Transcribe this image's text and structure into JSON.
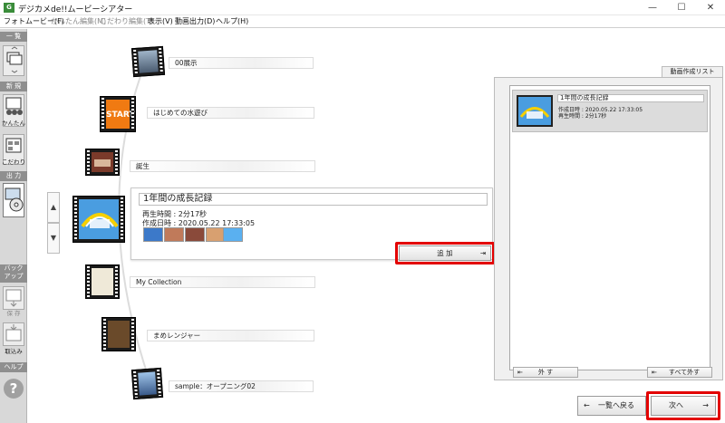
{
  "window": {
    "title": "デジカメde!!ムービーシアター",
    "app_icon": "G",
    "minimize": "—",
    "maximize": "☐",
    "close": "✕"
  },
  "menu": [
    {
      "label": "フォトムービー(F)",
      "enabled": true
    },
    {
      "label": "かんたん編集(M)",
      "enabled": false
    },
    {
      "label": "こだわり編集(T)",
      "enabled": false
    },
    {
      "label": "表示(V)",
      "enabled": true
    },
    {
      "label": "動画出力(D)",
      "enabled": true
    },
    {
      "label": "ヘルプ(H)",
      "enabled": true
    }
  ],
  "sidebar": {
    "list_header": "一 覧",
    "new_header": "新 規",
    "easy_label": "かんたん",
    "custom_label": "こだわり",
    "output_header": "出 力",
    "backup_header": "バック\nアップ",
    "save_label": "保 存",
    "import_label": "取込み",
    "help_header": "ヘルプ",
    "help_glyph": "?"
  },
  "projects": [
    {
      "title": "00展示"
    },
    {
      "title": "はじめての水遊び",
      "thumb_text": "START"
    },
    {
      "title": "誕生"
    },
    {
      "title": "My Collection"
    },
    {
      "title": "まめレンジャー"
    },
    {
      "title": "sample：オープニング02"
    }
  ],
  "selected": {
    "title": "1年間の成長記録",
    "duration": "再生時間 : 2分17秒",
    "created": "作成日時 : 2020.05.22 17:33:05",
    "thumb_caption": "1年間の成長記録"
  },
  "scroll": {
    "up": "▲",
    "down": "▼"
  },
  "add_button": {
    "label": "追 加",
    "icon": "⇥"
  },
  "right_panel": {
    "tab": "動画作成リスト",
    "item": {
      "title": "1年間の成長記録",
      "created": "作成日時 : 2020.05.22 17:33:05",
      "duration": "再生時間 : 2分17秒"
    },
    "remove_label": "外 す",
    "remove_all_label": "すべて外す",
    "remove_icon": "⇤"
  },
  "footer": {
    "back_label": "一覧へ戻る",
    "back_arrow": "←",
    "next_label": "次へ",
    "next_arrow": "→"
  },
  "colors": {
    "highlight": "#e30000",
    "sidebar_head": "#8f8f8f"
  }
}
